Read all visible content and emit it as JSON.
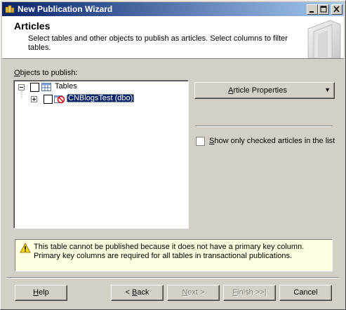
{
  "window": {
    "title": "New Publication Wizard"
  },
  "header": {
    "title": "Articles",
    "description": "Select tables and other objects to publish as articles. Select columns to filter tables."
  },
  "objects": {
    "label_mnemonic": "O",
    "label_rest": "bjects to publish:",
    "tree": {
      "root_label": "Tables",
      "child_label": "CNBlogsTest (dbo)"
    }
  },
  "article_properties": {
    "label_prefix": "",
    "label_mnemonic": "A",
    "label_rest": "rticle Properties",
    "arrow": "▼"
  },
  "show_checked": {
    "label_prefix": "",
    "label_mnemonic": "S",
    "label_rest": "how only checked articles in the list",
    "checked": false
  },
  "info": {
    "icon": "warning-icon",
    "message": "This table cannot be published because it does not have a primary key column. Primary key columns are required for all tables in transactional publications."
  },
  "buttons": {
    "help": {
      "mnemonic": "H",
      "rest": "elp"
    },
    "back": {
      "prefix": "< ",
      "mnemonic": "B",
      "rest": "ack"
    },
    "next": {
      "mnemonic": "N",
      "rest": "ext >"
    },
    "finish": {
      "mnemonic": "F",
      "rest": "inish >>|"
    },
    "cancel": {
      "label": "Cancel"
    }
  }
}
